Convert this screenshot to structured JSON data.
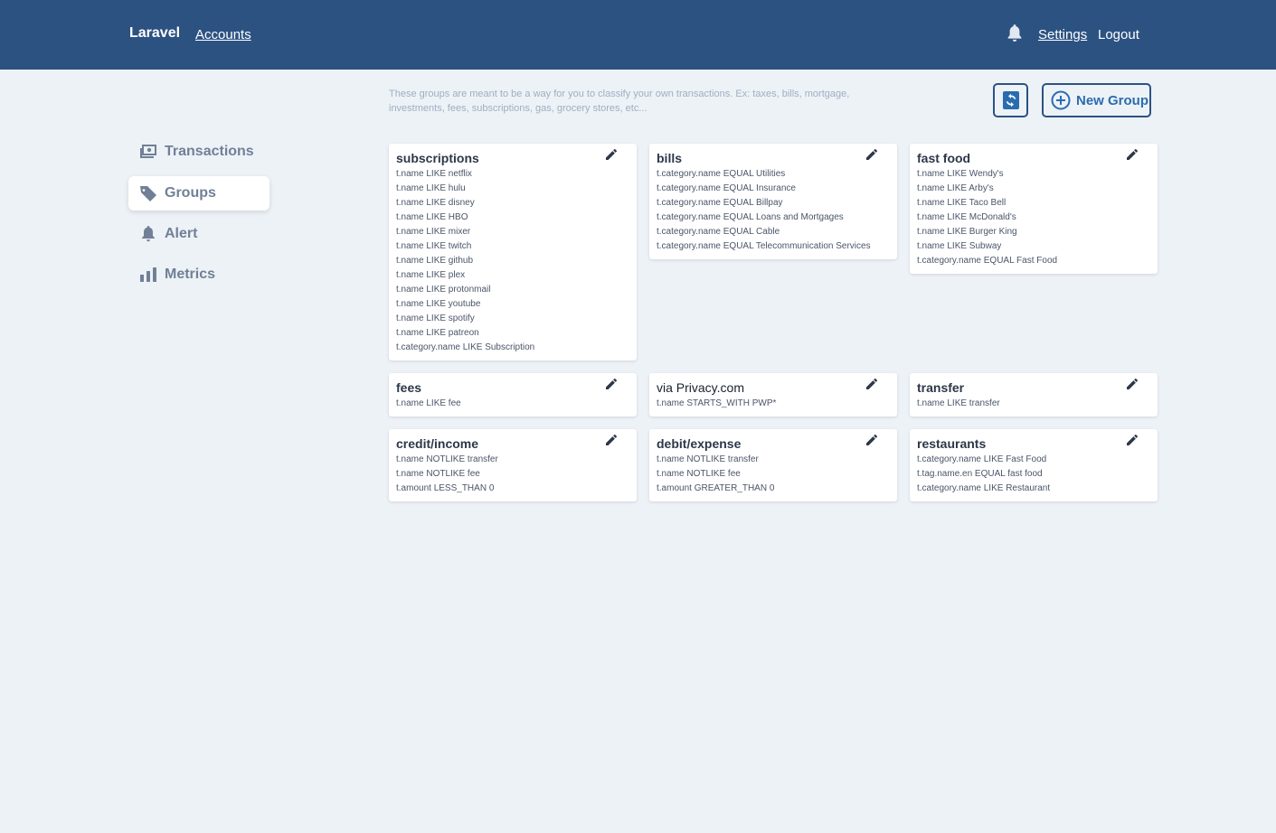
{
  "header": {
    "brand": "Laravel",
    "accounts_label": "Accounts",
    "settings_label": "Settings",
    "logout_label": "Logout"
  },
  "sidebar": {
    "items": [
      {
        "label": "Transactions",
        "icon": "money-icon"
      },
      {
        "label": "Groups",
        "icon": "tag-icon",
        "active": true
      },
      {
        "label": "Alert",
        "icon": "bell-icon"
      },
      {
        "label": "Metrics",
        "icon": "bar-chart-icon"
      }
    ]
  },
  "intro": "These groups are meant to be a way for you to classify your own transactions. Ex: taxes, bills, mortgage, investments, fees, subscriptions, gas, grocery stores, etc...",
  "actions": {
    "new_group_label": "New Group"
  },
  "groups": [
    {
      "title": "subscriptions",
      "rules": [
        "t.name LIKE netflix",
        "t.name LIKE hulu",
        "t.name LIKE disney",
        "t.name LIKE HBO",
        "t.name LIKE mixer",
        "t.name LIKE twitch",
        "t.name LIKE github",
        "t.name LIKE plex",
        "t.name LIKE protonmail",
        "t.name LIKE youtube",
        "t.name LIKE spotify",
        "t.name LIKE patreon",
        "t.category.name LIKE Subscription"
      ]
    },
    {
      "title": "bills",
      "rules": [
        "t.category.name EQUAL Utilities",
        "t.category.name EQUAL Insurance",
        "t.category.name EQUAL Billpay",
        "t.category.name EQUAL Loans and Mortgages",
        "t.category.name EQUAL Cable",
        "t.category.name EQUAL Telecommunication Services"
      ]
    },
    {
      "title": "fast food",
      "rules": [
        "t.name LIKE Wendy's",
        "t.name LIKE Arby's",
        "t.name LIKE Taco Bell",
        "t.name LIKE McDonald's",
        "t.name LIKE Burger King",
        "t.name LIKE Subway",
        "t.category.name EQUAL Fast Food"
      ]
    },
    {
      "title": "fees",
      "rules": [
        "t.name LIKE fee"
      ]
    },
    {
      "title": "via Privacy.com",
      "rules": [
        "t.name STARTS_WITH PWP*"
      ]
    },
    {
      "title": "transfer",
      "rules": [
        "t.name LIKE transfer"
      ]
    },
    {
      "title": "credit/income",
      "rules": [
        "t.name NOTLIKE transfer",
        "t.name NOTLIKE fee",
        "t.amount LESS_THAN 0"
      ]
    },
    {
      "title": "debit/expense",
      "rules": [
        "t.name NOTLIKE transfer",
        "t.name NOTLIKE fee",
        "t.amount GREATER_THAN 0"
      ]
    },
    {
      "title": "restaurants",
      "rules": [
        "t.category.name LIKE Fast Food",
        "t.tag.name.en EQUAL fast food",
        "t.category.name LIKE Restaurant"
      ]
    }
  ]
}
